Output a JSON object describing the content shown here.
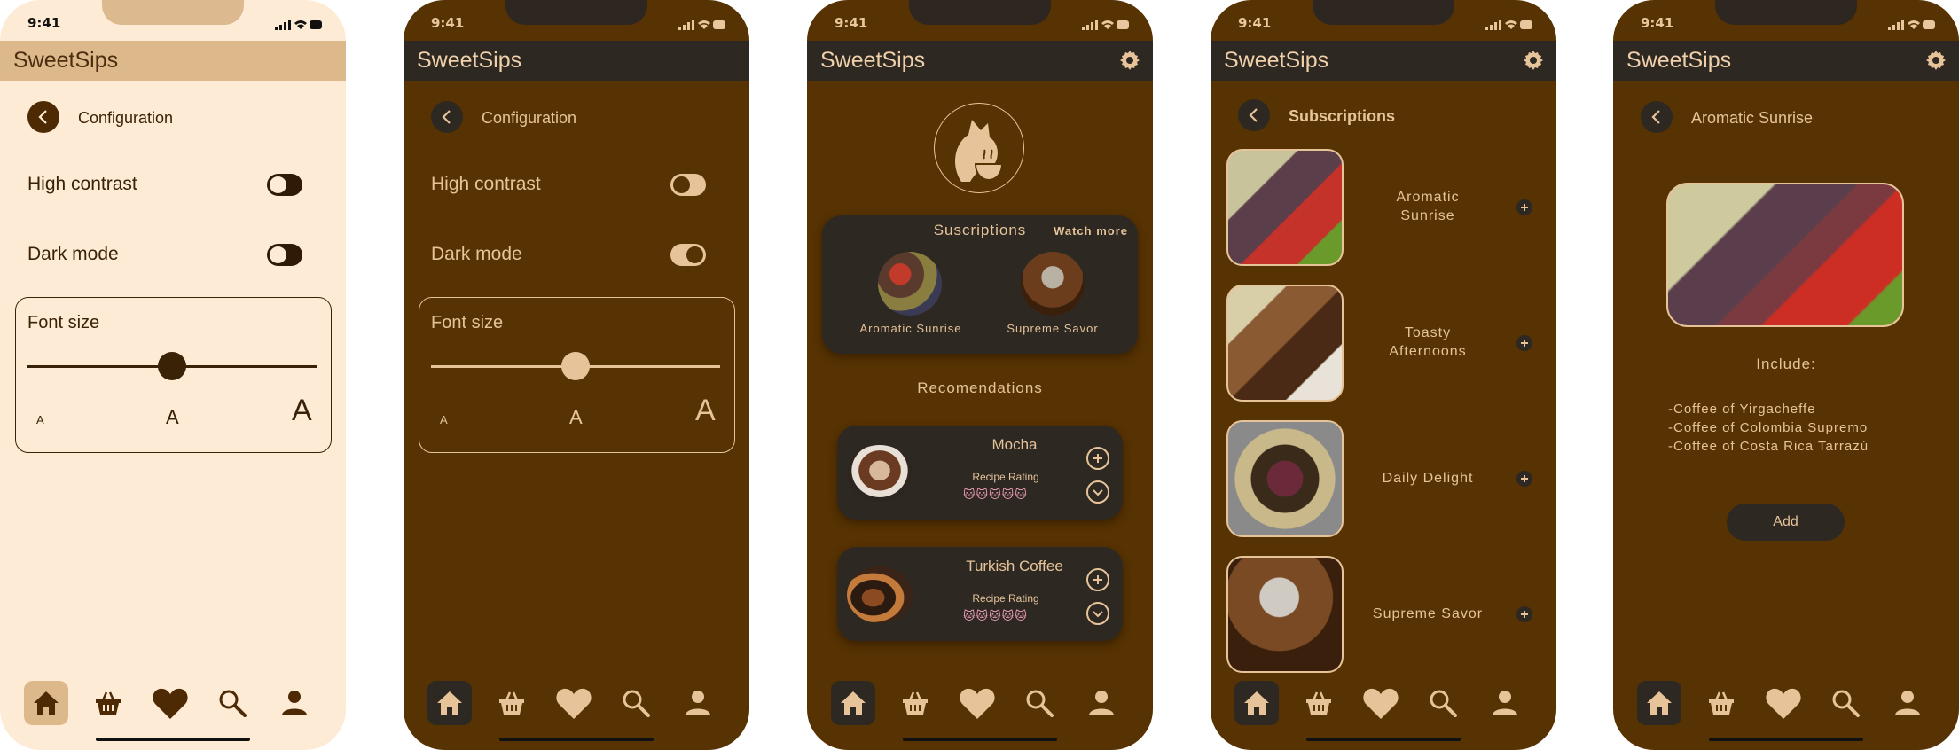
{
  "colors": {
    "light_bg": "#feebd6",
    "light_bar": "#ddb88b",
    "dark_bg": "#573202",
    "dark_card": "#2d2822",
    "accent": "#e7c39a"
  },
  "status": {
    "time": "9:41"
  },
  "app": {
    "title": "SweetSips"
  },
  "config": {
    "crumb": "Configuration",
    "high_contrast": "High contrast",
    "dark_mode": "Dark mode",
    "font_size": "Font size",
    "font_small": "A",
    "font_medium": "A",
    "font_large": "A",
    "font_level": 0.5,
    "light": {
      "high_contrast_on": false,
      "dark_mode_on": false
    },
    "dark": {
      "high_contrast_on": false,
      "dark_mode_on": true
    }
  },
  "home": {
    "subscriptions_title": "Suscriptions",
    "watch_more": "Watch more",
    "subs": [
      {
        "name": "Aromatic Sunrise"
      },
      {
        "name": "Supreme Savor"
      }
    ],
    "recommendations_title": "Recomendations",
    "recipes": [
      {
        "name": "Mocha",
        "rating_label": "Recipe Rating",
        "rating": 5
      },
      {
        "name": "Turkish Coffee",
        "rating_label": "Recipe Rating",
        "rating": 5
      }
    ]
  },
  "subscriptions": {
    "crumb": "Subscriptions",
    "items": [
      {
        "name_line1": "Aromatic",
        "name_line2": "Sunrise"
      },
      {
        "name_line1": "Toasty",
        "name_line2": "Afternoons"
      },
      {
        "name_line1": "Daily Delight",
        "name_line2": ""
      },
      {
        "name_line1": "Supreme Savor",
        "name_line2": ""
      }
    ]
  },
  "detail": {
    "crumb": "Aromatic Sunrise",
    "include_label": "Include:",
    "items": [
      "-Coffee of Yirgacheffe",
      "-Coffee of Colombia Supremo",
      "-Coffee of Costa Rica Tarrazú"
    ],
    "add_label": "Add"
  },
  "nav": {
    "icons": [
      "home-icon",
      "basket-icon",
      "heart-icon",
      "search-icon",
      "user-icon"
    ]
  }
}
